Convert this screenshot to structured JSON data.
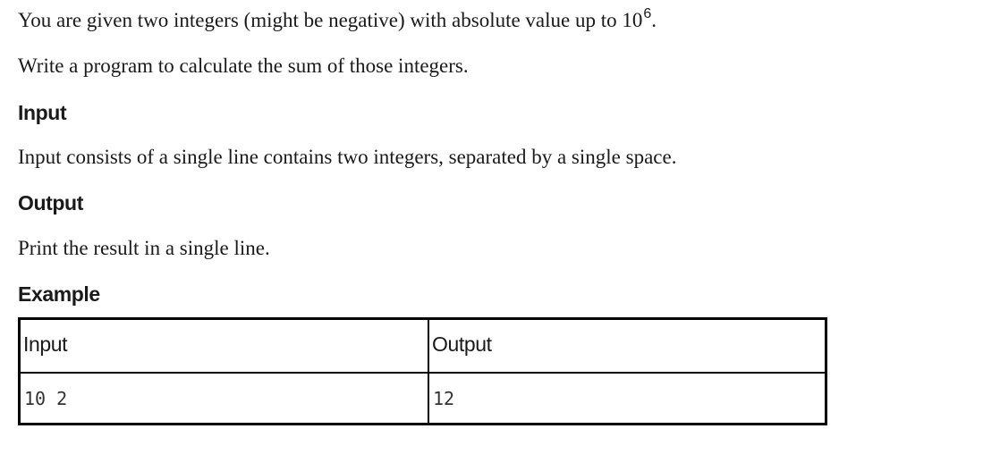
{
  "statement": {
    "p1_text": "You are given two integers (might be negative) with absolute value up to 10",
    "p1_sup": "6",
    "p1_tail": ".",
    "p2": "Write a program to calculate the sum of those integers.",
    "input_heading": "Input",
    "input_text": "Input consists of a single line contains two integers, separated by a single space.",
    "output_heading": "Output",
    "output_text": "Print the result in a single line.",
    "example_heading": "Example"
  },
  "example": {
    "headers": [
      "Input",
      "Output"
    ],
    "rows": [
      [
        "10 2",
        "12"
      ]
    ]
  }
}
